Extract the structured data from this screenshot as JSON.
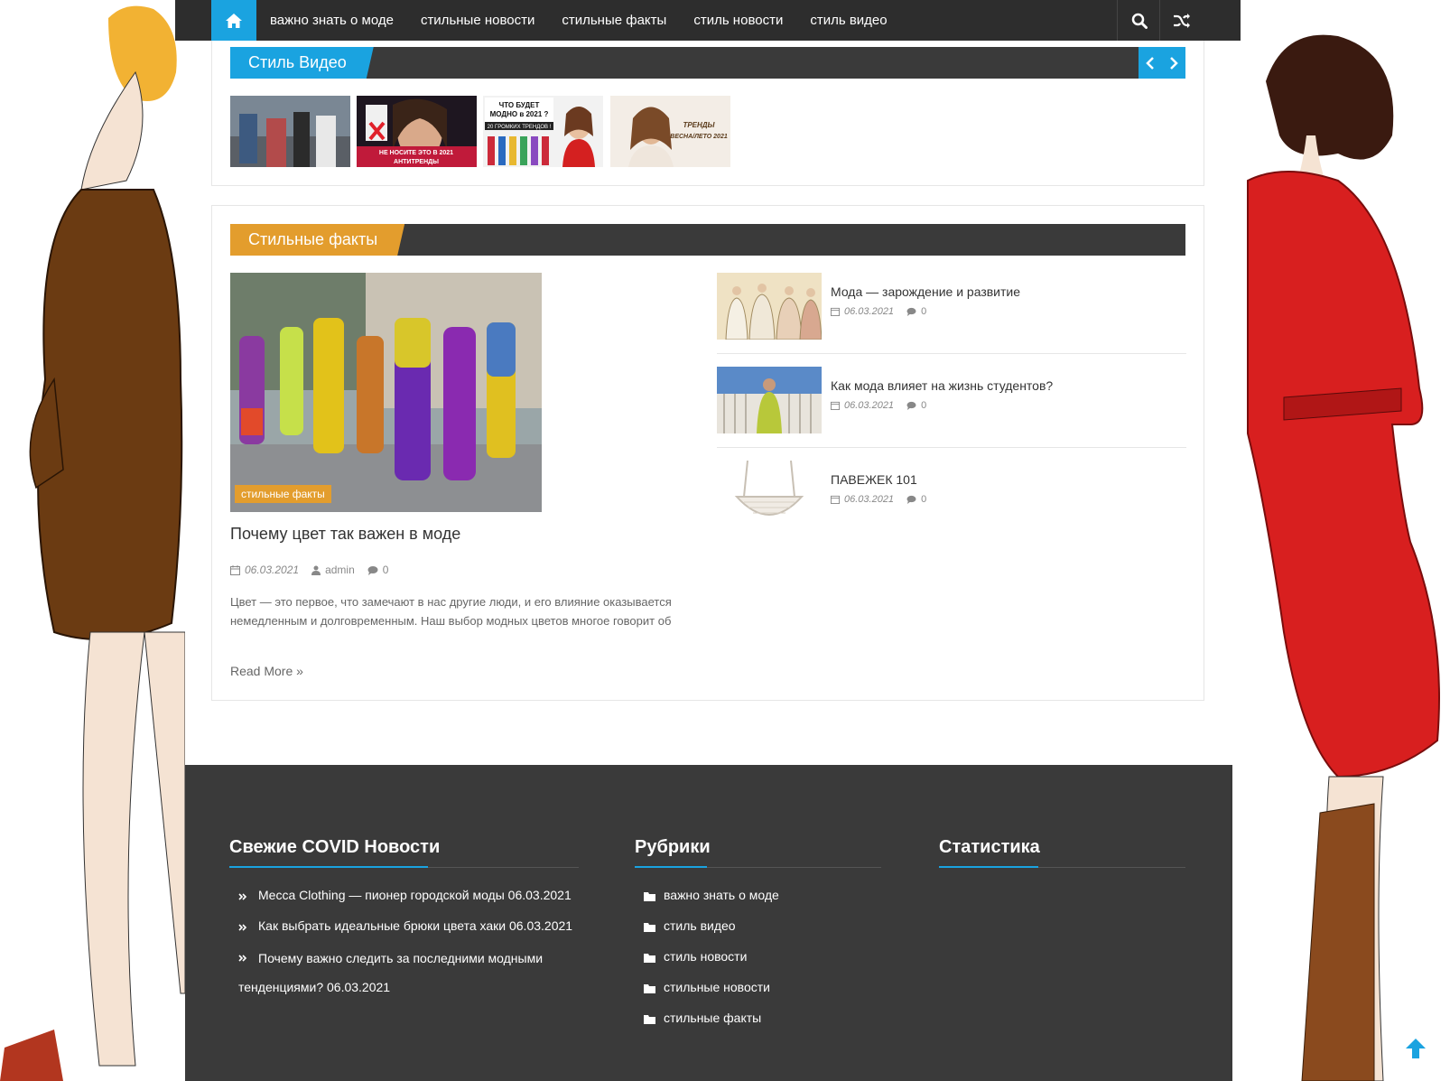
{
  "nav": {
    "items": [
      "важно знать о моде",
      "стильные новости",
      "стильные факты",
      "стиль новости",
      "стиль видео"
    ]
  },
  "video_section": {
    "title": "Стиль Видео",
    "thumbnails": [
      {
        "caption": ""
      },
      {
        "caption": "НЕ НОСИТЕ ЭТО В 2021 АНТИТРЕНДЫ"
      },
      {
        "caption": "ЧТО БУДЕТ МОДНО в 2021 ? 20 ГРОМКИХ ТРЕНДОВ !"
      },
      {
        "caption": "ТРЕНДЫ ВЕСНА/ЛЕТО 2021"
      }
    ]
  },
  "facts_section": {
    "title": "Стильные факты",
    "featured": {
      "category": "стильные факты",
      "title": "Почему цвет так важен в моде",
      "date": "06.03.2021",
      "author": "admin",
      "comments": "0",
      "excerpt": "Цвет — это первое, что замечают в нас другие люди, и его влияние оказывается немедленным и долговременным. Наш выбор модных цветов многое говорит об",
      "read_more": "Read More »"
    },
    "side_posts": [
      {
        "title": "Мода — зарождение и развитие",
        "date": "06.03.2021",
        "comments": "0"
      },
      {
        "title": "Как мода влияет на жизнь студентов?",
        "date": "06.03.2021",
        "comments": "0"
      },
      {
        "title": "ПАВЕЖЕК 101",
        "date": "06.03.2021",
        "comments": "0"
      }
    ]
  },
  "footer": {
    "covid": {
      "title": "Свежие COVID Новости",
      "items": [
        "Mecca Clothing — пионер городской моды 06.03.2021",
        "Как выбрать идеальные брюки цвета хаки 06.03.2021",
        "Почему важно следить за последними модными тенденциями? 06.03.2021"
      ]
    },
    "rubrics": {
      "title": "Рубрики",
      "items": [
        "важно знать о моде",
        "стиль видео",
        "стиль новости",
        "стильные новости",
        "стильные факты"
      ]
    },
    "stats": {
      "title": "Статистика"
    }
  },
  "colors": {
    "accent": "#1aa3e0",
    "facts_accent": "#e39d2d",
    "dark": "#3a3a3a"
  }
}
